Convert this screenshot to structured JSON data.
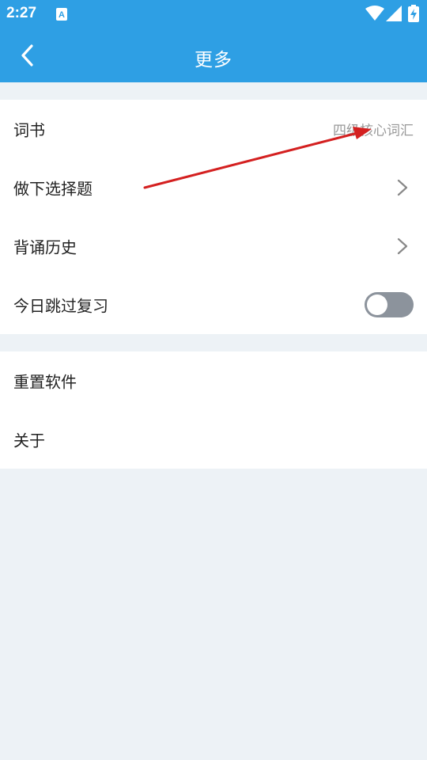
{
  "status_bar": {
    "time": "2:27",
    "notification_icon": "a-letter-icon",
    "icons": [
      "wifi-icon",
      "signal-icon",
      "battery-charging-icon"
    ]
  },
  "header": {
    "title": "更多",
    "back_icon": "chevron-left-icon"
  },
  "settings": {
    "group1": [
      {
        "label": "词书",
        "value": "四级核心词汇",
        "type": "value"
      },
      {
        "label": "做下选择题",
        "type": "chevron"
      },
      {
        "label": "背诵历史",
        "type": "chevron"
      },
      {
        "label": "今日跳过复习",
        "type": "toggle",
        "toggle_on": false
      }
    ],
    "group2": [
      {
        "label": "重置软件"
      },
      {
        "label": "关于"
      }
    ]
  },
  "colors": {
    "primary": "#2e9fe4",
    "background": "#edf2f6",
    "toggle_off": "#8c939c",
    "annotation_arrow": "#d42020"
  }
}
